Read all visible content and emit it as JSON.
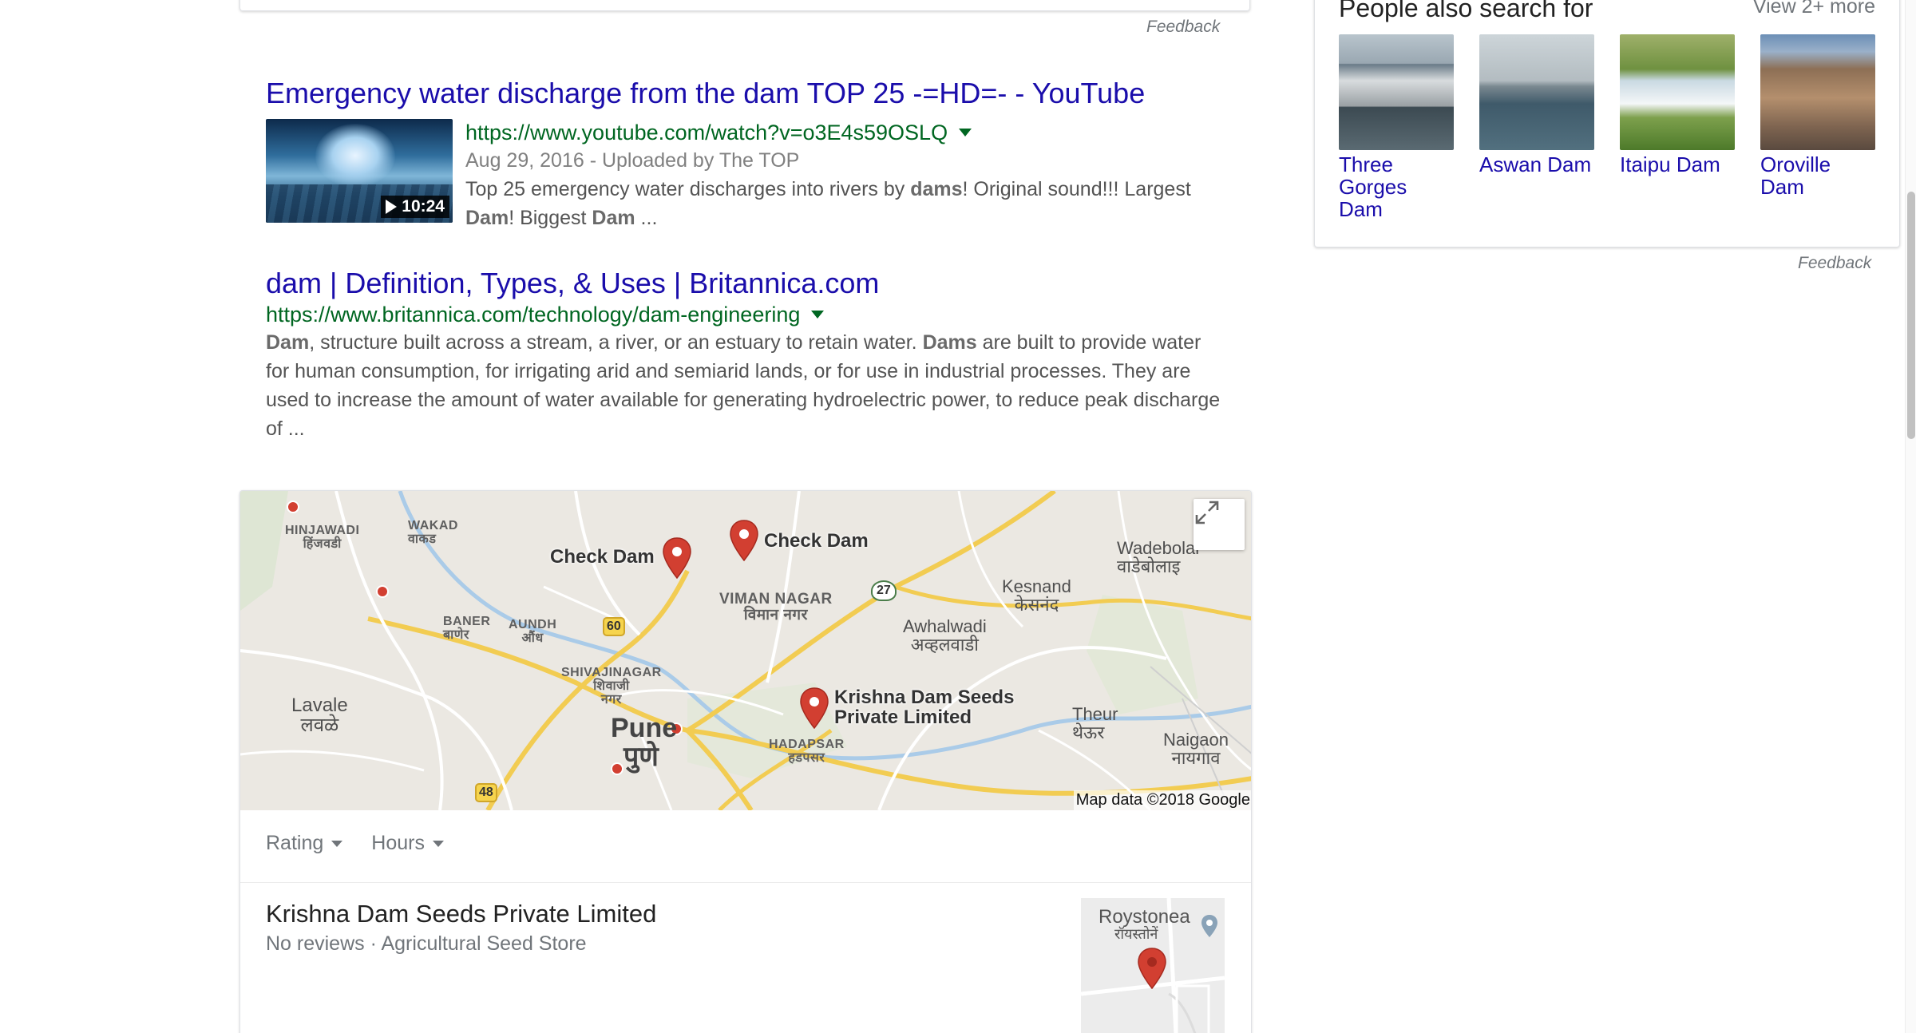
{
  "feedback_label": "Feedback",
  "results": [
    {
      "title": "Emergency water discharge from the dam TOP 25 -=HD=- - YouTube",
      "url": "https://www.youtube.com/watch?v=o3E4s59OSLQ",
      "date_line": "Aug 29, 2016 - Uploaded by The TOP",
      "duration": "10:24",
      "snippet_parts": [
        "Top 25 emergency water discharges into rivers by ",
        "dams",
        "! Original sound!!! Largest ",
        "Dam",
        "! Biggest ",
        "Dam",
        " ..."
      ]
    },
    {
      "title": "dam | Definition, Types, & Uses | Britannica.com",
      "url": "https://www.britannica.com/technology/dam-engineering",
      "snippet_parts": [
        "Dam",
        ", structure built across a stream, a river, or an estuary to retain water. ",
        "Dams",
        " are built to provide water for human consumption, for irrigating arid and semiarid lands, or for use in industrial processes. They are used to increase the amount of water available for generating hydroelectric power, to reduce peak discharge of ..."
      ]
    }
  ],
  "map": {
    "labels": {
      "hinjawadi_en": "HINJAWADI",
      "hinjawadi_mr": "हिंजवडी",
      "wakad_en": "WAKAD",
      "wakad_mr": "वाकड",
      "checkdam1": "Check Dam",
      "checkdam2": "Check Dam",
      "wadebolai_en": "Wadebolai",
      "wadebolai_mr": "वाडेबोलाइ",
      "kesnand_en": "Kesnand",
      "kesnand_mr": "केसनंद",
      "vimannagar_en": "VIMAN NAGAR",
      "vimannagar_mr": "विमान नगर",
      "baner_en": "BANER",
      "baner_mr": "बाणेर",
      "aundh_en": "AUNDH",
      "aundh_mr": "औंध",
      "awhalwadi_en": "Awhalwadi",
      "awhalwadi_mr": "अव्हलवाडी",
      "shivajinagar_en": "SHIVAJINAGAR",
      "shivajinagar_mr": "शिवाजी",
      "shivajinagar_mr2": "नगर",
      "krishna": "Krishna Dam Seeds",
      "krishna2": "Private Limited",
      "lavale_en": "Lavale",
      "lavale_mr": "लवळे",
      "pune_en": "Pune",
      "pune_mr": "पुणे",
      "theur_en": "Theur",
      "theur_mr": "थेऊर",
      "naigaon_en": "Naigaon",
      "naigaon_mr": "नायगाव",
      "hadapsar_en": "HADAPSAR",
      "hadapsar_mr": "हडपसर"
    },
    "shields": {
      "nh27": "27",
      "nh60": "60",
      "nh48": "48"
    },
    "credit": "Map data ©2018 Google",
    "expand_icon": "expand-icon"
  },
  "filters": [
    {
      "label": "Rating"
    },
    {
      "label": "Hours"
    }
  ],
  "listing": {
    "name": "Krishna Dam Seeds Private Limited",
    "meta": "No reviews · Agricultural Seed Store",
    "mini_map_label": "Roystonea",
    "mini_map_label_mr": "रॉयस्तोनें"
  },
  "people_also_search": {
    "heading": "People also search for",
    "more_label": "View 2+ more",
    "items": [
      {
        "name": "Three Gorges Dam"
      },
      {
        "name": "Aswan Dam"
      },
      {
        "name": "Itaipu Dam"
      },
      {
        "name": "Oroville Dam"
      }
    ]
  },
  "colors": {
    "link": "#1a0dab",
    "url": "#006621",
    "pin": "#d23f31"
  }
}
